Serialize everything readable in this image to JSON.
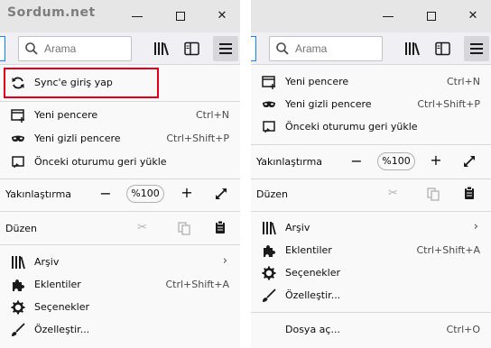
{
  "watermark": "Sordum.net",
  "search": {
    "placeholder": "Arama"
  },
  "left_menu": {
    "sync": "Sync'e giriş yap",
    "new_window": {
      "label": "Yeni pencere",
      "shortcut": "Ctrl+N"
    },
    "private_window": {
      "label": "Yeni gizli pencere",
      "shortcut": "Ctrl+Shift+P"
    },
    "restore_session": {
      "label": "Önceki oturumu geri yükle"
    },
    "zoom": {
      "label": "Yakınlaştırma",
      "minus": "−",
      "value": "%100",
      "plus": "+"
    },
    "edit": {
      "label": "Düzen"
    },
    "library": {
      "label": "Arşiv",
      "arrow": "›"
    },
    "addons": {
      "label": "Eklentiler",
      "shortcut": "Ctrl+Shift+A"
    },
    "options": {
      "label": "Seçenekler"
    },
    "customize": {
      "label": "Özelleştir..."
    }
  },
  "right_menu": {
    "new_window": {
      "label": "Yeni pencere",
      "shortcut": "Ctrl+N"
    },
    "private_window": {
      "label": "Yeni gizli pencere",
      "shortcut": "Ctrl+Shift+P"
    },
    "restore_session": {
      "label": "Önceki oturumu geri yükle"
    },
    "zoom": {
      "label": "Yakınlaştırma",
      "minus": "−",
      "value": "%100",
      "plus": "+"
    },
    "edit": {
      "label": "Düzen"
    },
    "library": {
      "label": "Arşiv",
      "arrow": "›"
    },
    "addons": {
      "label": "Eklentiler",
      "shortcut": "Ctrl+Shift+A"
    },
    "options": {
      "label": "Seçenekler"
    },
    "customize": {
      "label": "Özelleştir..."
    },
    "open_file": {
      "label": "Dosya aç...",
      "shortcut": "Ctrl+O"
    }
  },
  "colors": {
    "highlight_border": "#e2001a",
    "panel_bg": "#f9f9fa",
    "titlebar": "#e6e6e6"
  }
}
